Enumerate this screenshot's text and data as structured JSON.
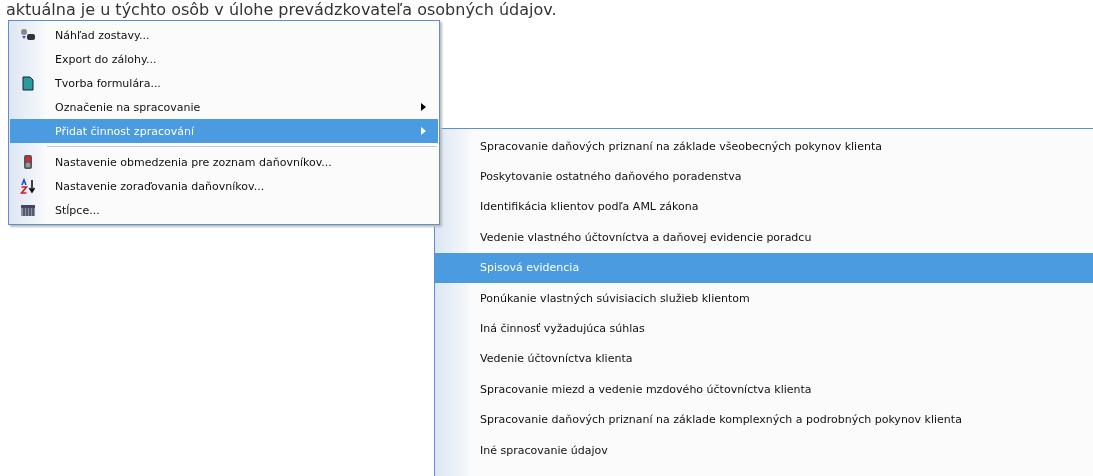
{
  "background_text": "aktuálna je u týchto osôb v úlohe prevádzkovateľa osobných údajov.",
  "menu": {
    "items": [
      {
        "label": "Náhľad zostavy...",
        "kind": "preview",
        "selected": false,
        "submenu": false
      },
      {
        "label": "Export do zálohy...",
        "kind": "plain",
        "selected": false,
        "submenu": false
      },
      {
        "label": "Tvorba formulára...",
        "kind": "form",
        "selected": false,
        "submenu": false
      },
      {
        "label": "Označenie na spracovanie",
        "kind": "plain",
        "selected": false,
        "submenu": true
      },
      {
        "label": "Přidat činnost zpracování",
        "kind": "plain",
        "selected": true,
        "submenu": true
      },
      {
        "kind": "separator"
      },
      {
        "label": "Nastavenie obmedzenia pre zoznam daňovníkov...",
        "kind": "filter",
        "selected": false,
        "submenu": false
      },
      {
        "label": "Nastavenie zoraďovania daňovníkov...",
        "kind": "sort",
        "selected": false,
        "submenu": false
      },
      {
        "label": "Stĺpce...",
        "kind": "columns",
        "selected": false,
        "submenu": false
      }
    ]
  },
  "submenu": {
    "items": [
      {
        "label": "Spracovanie daňových priznaní na základe všeobecných pokynov klienta",
        "selected": false
      },
      {
        "label": "Poskytovanie ostatného daňového poradenstva",
        "selected": false
      },
      {
        "label": "Identifikácia klientov podľa AML zákona",
        "selected": false
      },
      {
        "label": "Vedenie vlastného účtovníctva a daňovej evidencie poradcu",
        "selected": false
      },
      {
        "label": "Spisová evidencia",
        "selected": true
      },
      {
        "label": "Ponúkanie vlastných súvisiacich služieb klientom",
        "selected": false
      },
      {
        "label": "Iná činnosť vyžadujúca súhlas",
        "selected": false
      },
      {
        "label": "Vedenie účtovníctva klienta",
        "selected": false
      },
      {
        "label": "Spracovanie miezd a vedenie mzdového účtovníctva klienta",
        "selected": false
      },
      {
        "label": "Spracovanie daňových priznaní na základe komplexných a podrobných pokynov klienta",
        "selected": false
      },
      {
        "label": "Iné spracovanie údajov",
        "selected": false
      }
    ]
  }
}
